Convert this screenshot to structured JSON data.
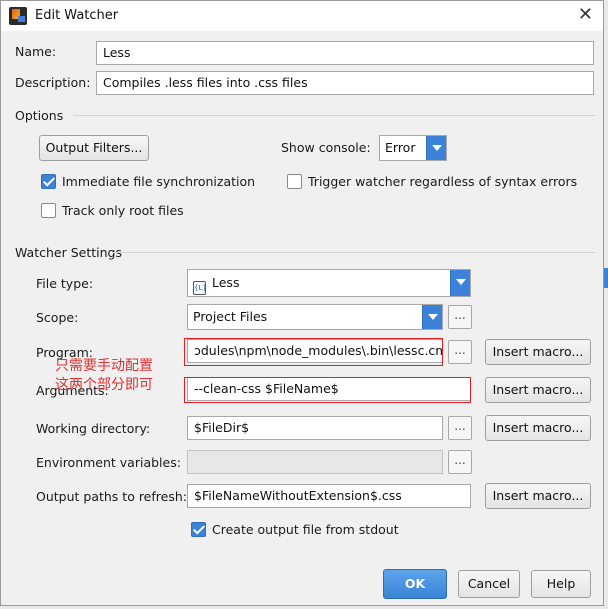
{
  "window": {
    "title": "Edit Watcher"
  },
  "name": {
    "label": "Name:",
    "value": "Less"
  },
  "description": {
    "label": "Description:",
    "value": "Compiles .less files into .css files"
  },
  "options": {
    "section_label": "Options",
    "output_filters_button": "Output Filters...",
    "show_console_label": "Show console:",
    "show_console_value": "Error",
    "immediate_sync_label": "Immediate file synchronization",
    "trigger_watcher_label": "Trigger watcher regardless of syntax errors",
    "track_root_label": "Track only root files"
  },
  "watcher": {
    "section_label": "Watcher Settings",
    "file_type_label": "File type:",
    "file_type_value": "Less",
    "file_type_icon_text": "{L}",
    "scope_label": "Scope:",
    "scope_value": "Project Files",
    "dots": "...",
    "program_label": "Program:",
    "program_value": "ɔdules\\npm\\node_modules\\.bin\\lessc.cmd",
    "arguments_label": "Arguments:",
    "arguments_value": "--clean-css $FileName$",
    "working_dir_label": "Working directory:",
    "working_dir_value": "$FileDir$",
    "env_vars_label": "Environment variables:",
    "env_vars_value": "",
    "output_paths_label": "Output paths to refresh:",
    "output_paths_value": "$FileNameWithoutExtension$.css",
    "insert_macro": "Insert macro...",
    "create_output_label": "Create output file from stdout"
  },
  "annotation": {
    "line1": "只需要手动配置",
    "line2": "这两个部分即可"
  },
  "footer": {
    "ok": "OK",
    "cancel": "Cancel",
    "help": "Help"
  },
  "colors": {
    "accent": "#3d82d9",
    "annotation_red": "#e02020"
  }
}
